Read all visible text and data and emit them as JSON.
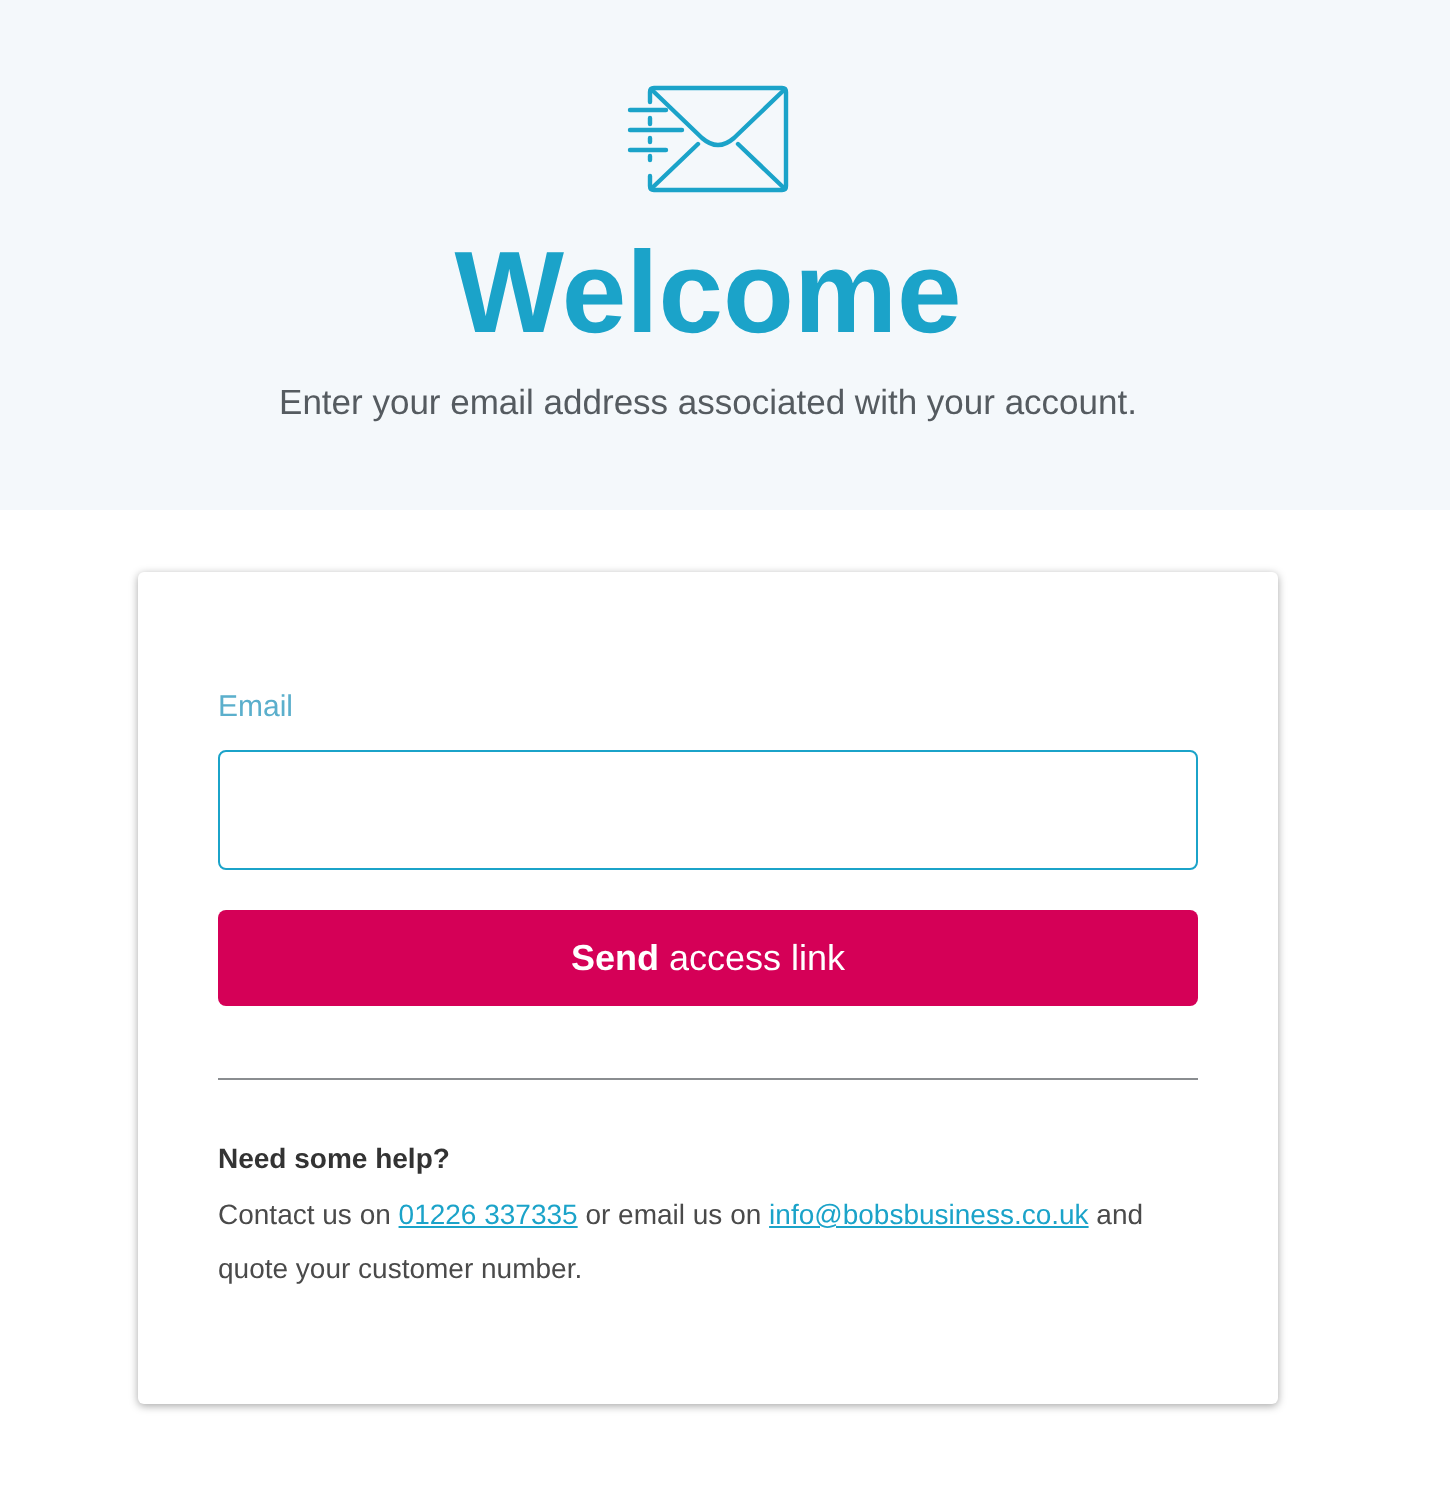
{
  "header": {
    "title": "Welcome",
    "subtitle": "Enter your email address associated with your account."
  },
  "form": {
    "email_field": {
      "label": "Email"
    },
    "submit_button": "**Send** access link"
  },
  "help": {
    "heading": "Need some help?",
    "text_parts": [
      {
        "kind": "text",
        "text": "Contact us on "
      },
      {
        "kind": "link",
        "text": "01226 337335"
      },
      {
        "kind": "text",
        "text": " or email us on "
      },
      {
        "kind": "link",
        "text": "info@bobsbusiness.co.uk"
      },
      {
        "kind": "text",
        "text": " and quote your customer number."
      }
    ]
  }
}
